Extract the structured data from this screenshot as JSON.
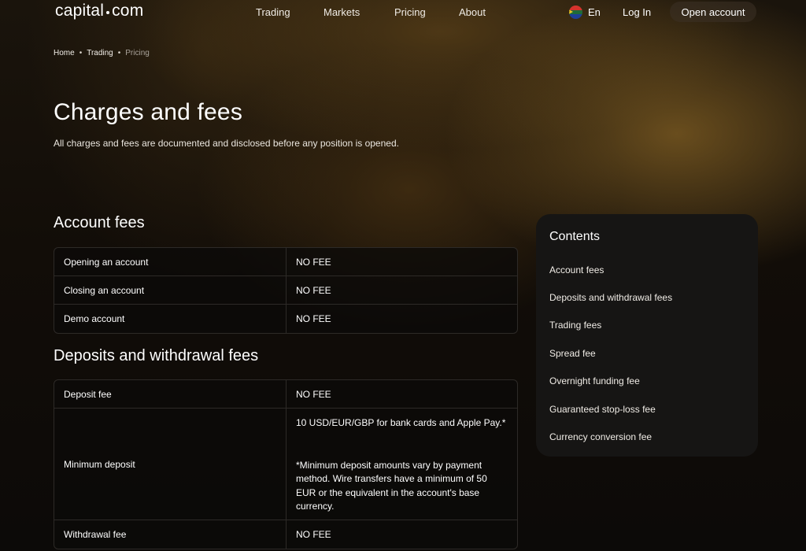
{
  "header": {
    "logo_left": "capital",
    "logo_right": "com",
    "nav": [
      "Trading",
      "Markets",
      "Pricing",
      "About"
    ],
    "language": "En",
    "login": "Log In",
    "open_account": "Open account"
  },
  "breadcrumb": [
    "Home",
    "Trading",
    "Pricing"
  ],
  "title": "Charges and fees",
  "subtitle": "All charges and fees are documented and disclosed before any position is opened.",
  "account_fees": {
    "heading": "Account fees",
    "rows": [
      {
        "label": "Opening an account",
        "value": "NO FEE"
      },
      {
        "label": "Closing an account",
        "value": "NO FEE"
      },
      {
        "label": "Demo account",
        "value": "NO FEE"
      }
    ]
  },
  "deposit_fees": {
    "heading": "Deposits and withdrawal fees",
    "deposit_fee": {
      "label": "Deposit fee",
      "value": "NO FEE"
    },
    "minimum_deposit": {
      "label": "Minimum deposit",
      "value": "10 USD/EUR/GBP for bank cards  and Apple Pay.*",
      "note": "*Minimum deposit amounts vary  by payment method. Wire transfers  have a minimum of 50 EUR or the  equivalent in the account's  base currency."
    },
    "withdrawal_fee": {
      "label": "Withdrawal fee",
      "value": "NO FEE"
    }
  },
  "contents": {
    "title": "Contents",
    "items": [
      "Account fees",
      "Deposits and withdrawal fees",
      "Trading fees",
      "Spread fee",
      "Overnight funding fee",
      "Guaranteed stop-loss fee",
      "Currency conversion fee"
    ]
  }
}
